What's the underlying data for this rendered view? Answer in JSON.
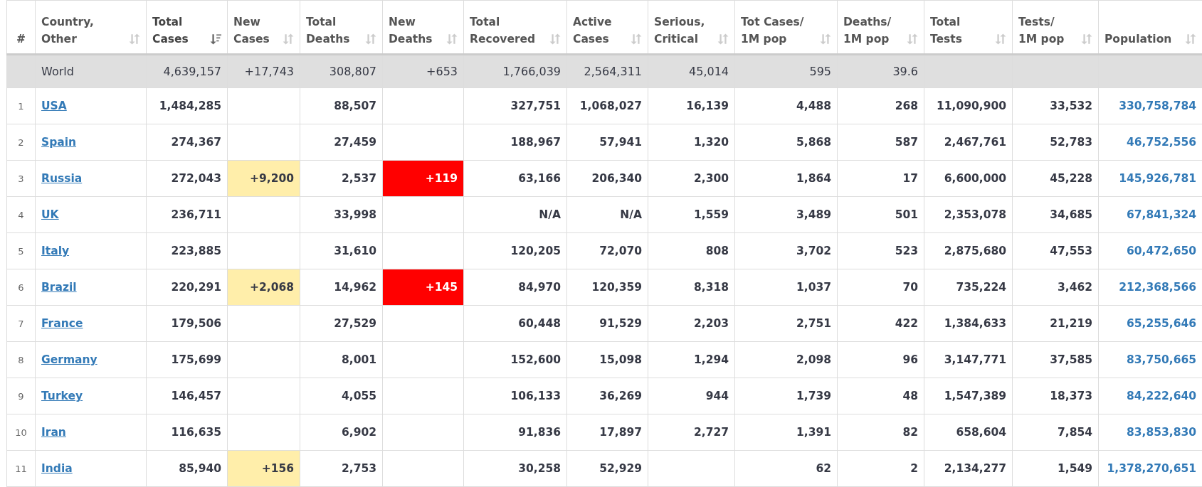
{
  "table": {
    "columns": [
      {
        "label": "#",
        "kind": "rank"
      },
      {
        "label": "Country,\nOther",
        "sorted": false,
        "kind": "country"
      },
      {
        "label": "Total\nCases",
        "sorted": true,
        "kind": "number"
      },
      {
        "label": "New\nCases",
        "sorted": false,
        "kind": "new_cases"
      },
      {
        "label": "Total\nDeaths",
        "sorted": false,
        "kind": "number"
      },
      {
        "label": "New\nDeaths",
        "sorted": false,
        "kind": "new_deaths"
      },
      {
        "label": "Total\nRecovered",
        "sorted": false,
        "kind": "number"
      },
      {
        "label": "Active\nCases",
        "sorted": false,
        "kind": "number"
      },
      {
        "label": "Serious,\nCritical",
        "sorted": false,
        "kind": "number"
      },
      {
        "label": "Tot Cases/\n1M pop",
        "sorted": false,
        "kind": "number"
      },
      {
        "label": "Deaths/\n1M pop",
        "sorted": false,
        "kind": "number"
      },
      {
        "label": "Total\nTests",
        "sorted": false,
        "kind": "number"
      },
      {
        "label": "Tests/\n1M pop",
        "sorted": false,
        "kind": "number"
      },
      {
        "label": "Population",
        "sorted": false,
        "kind": "population"
      }
    ],
    "total": [
      "World",
      "4,639,157",
      "+17,743",
      "308,807",
      "+653",
      "1,766,039",
      "2,564,311",
      "45,014",
      "595",
      "39.6"
    ],
    "rows": [
      [
        "1",
        "USA",
        "1,484,285",
        null,
        "88,507",
        null,
        "327,751",
        "1,068,027",
        "16,139",
        "4,488",
        "268",
        "11,090,900",
        "33,532",
        "330,758,784"
      ],
      [
        "2",
        "Spain",
        "274,367",
        null,
        "27,459",
        null,
        "188,967",
        "57,941",
        "1,320",
        "5,868",
        "587",
        "2,467,761",
        "52,783",
        "46,752,556"
      ],
      [
        "3",
        "Russia",
        "272,043",
        "+9,200",
        "2,537",
        "+119",
        "63,166",
        "206,340",
        "2,300",
        "1,864",
        "17",
        "6,600,000",
        "45,228",
        "145,926,781"
      ],
      [
        "4",
        "UK",
        "236,711",
        null,
        "33,998",
        null,
        "N/A",
        "N/A",
        "1,559",
        "3,489",
        "501",
        "2,353,078",
        "34,685",
        "67,841,324"
      ],
      [
        "5",
        "Italy",
        "223,885",
        null,
        "31,610",
        null,
        "120,205",
        "72,070",
        "808",
        "3,702",
        "523",
        "2,875,680",
        "47,553",
        "60,472,650"
      ],
      [
        "6",
        "Brazil",
        "220,291",
        "+2,068",
        "14,962",
        "+145",
        "84,970",
        "120,359",
        "8,318",
        "1,037",
        "70",
        "735,224",
        "3,462",
        "212,368,566"
      ],
      [
        "7",
        "France",
        "179,506",
        null,
        "27,529",
        null,
        "60,448",
        "91,529",
        "2,203",
        "2,751",
        "422",
        "1,384,633",
        "21,219",
        "65,255,646"
      ],
      [
        "8",
        "Germany",
        "175,699",
        null,
        "8,001",
        null,
        "152,600",
        "15,098",
        "1,294",
        "2,098",
        "96",
        "3,147,771",
        "37,585",
        "83,750,665"
      ],
      [
        "9",
        "Turkey",
        "146,457",
        null,
        "4,055",
        null,
        "106,133",
        "36,269",
        "944",
        "1,739",
        "48",
        "1,547,389",
        "18,373",
        "84,222,640"
      ],
      [
        "10",
        "Iran",
        "116,635",
        null,
        "6,902",
        null,
        "91,836",
        "17,897",
        "2,727",
        "1,391",
        "82",
        "658,604",
        "7,854",
        "83,853,830"
      ],
      [
        "11",
        "India",
        "85,940",
        "+156",
        "2,753",
        null,
        "30,258",
        "52,929",
        null,
        "62",
        "2",
        "2,134,277",
        "1,549",
        "1,378,270,651"
      ]
    ]
  }
}
